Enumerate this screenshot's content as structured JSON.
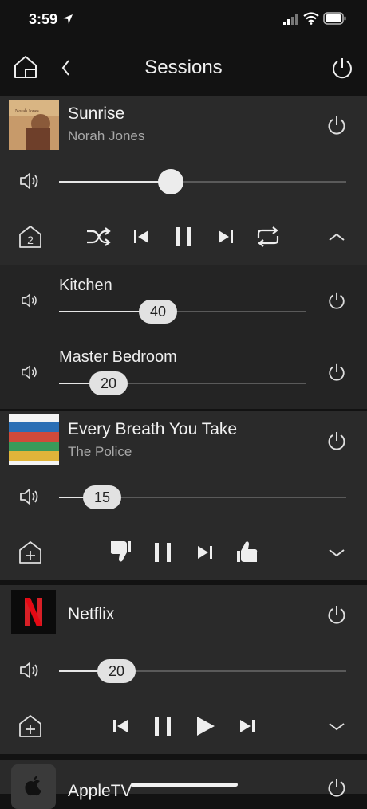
{
  "status": {
    "time": "3:59"
  },
  "nav": {
    "title": "Sessions"
  },
  "sessions": [
    {
      "title": "Sunrise",
      "artist": "Norah Jones",
      "album_art": "Norah Jones",
      "volume": 0.39,
      "group_count": "2",
      "rooms": [
        {
          "name": "Kitchen",
          "volume": "40",
          "level": 0.4
        },
        {
          "name": "Master Bedroom",
          "volume": "20",
          "level": 0.2
        }
      ]
    },
    {
      "title": "Every Breath You Take",
      "artist": "The Police",
      "volume": "15",
      "level": 0.15
    },
    {
      "title": "Netflix",
      "volume": "20",
      "level": 0.2
    },
    {
      "title": "AppleTV"
    }
  ]
}
